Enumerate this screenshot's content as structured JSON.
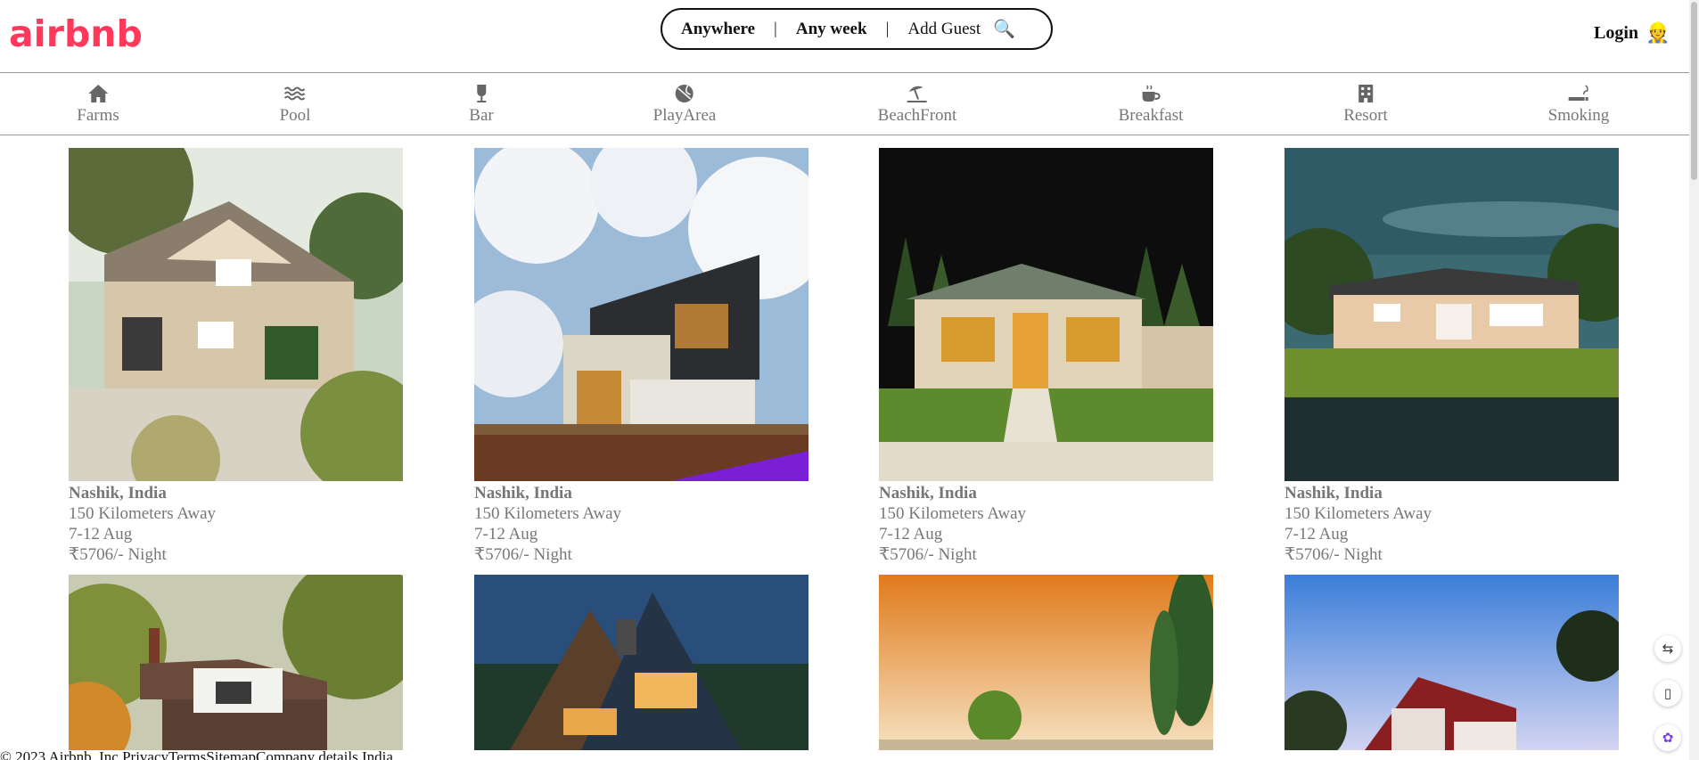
{
  "header": {
    "logo": "airbnb",
    "search": {
      "where": "Anywhere",
      "divider": "|",
      "when": "Any week",
      "guests": "Add Guest",
      "search_icon": "🔍"
    },
    "login": {
      "label": "Login",
      "avatar_icon": "👷"
    }
  },
  "categories": [
    {
      "label": "Farms",
      "icon": "home-icon"
    },
    {
      "label": "Pool",
      "icon": "waves-icon"
    },
    {
      "label": "Bar",
      "icon": "wine-glass-icon"
    },
    {
      "label": "PlayArea",
      "icon": "ball-icon"
    },
    {
      "label": "BeachFront",
      "icon": "umbrella-beach-icon"
    },
    {
      "label": "Breakfast",
      "icon": "coffee-cup-icon"
    },
    {
      "label": "Resort",
      "icon": "building-icon"
    },
    {
      "label": "Smoking",
      "icon": "smoking-icon"
    }
  ],
  "listings": [
    {
      "location": "Nashik, India",
      "distance": "150 Kilometers Away",
      "dates": "7-12 Aug",
      "price": "₹5706/- Night"
    },
    {
      "location": "Nashik, India",
      "distance": "150 Kilometers Away",
      "dates": "7-12 Aug",
      "price": "₹5706/- Night"
    },
    {
      "location": "Nashik, India",
      "distance": "150 Kilometers Away",
      "dates": "7-12 Aug",
      "price": "₹5706/- Night"
    },
    {
      "location": "Nashik, India",
      "distance": "150 Kilometers Away",
      "dates": "7-12 Aug",
      "price": "₹5706/- Night"
    }
  ],
  "footer": {
    "text": "© 2023 Airbnb, Inc.PrivacyTermsSitemapCompany details  India"
  },
  "colors": {
    "brand": "#ff385c",
    "muted_text": "#777777"
  }
}
